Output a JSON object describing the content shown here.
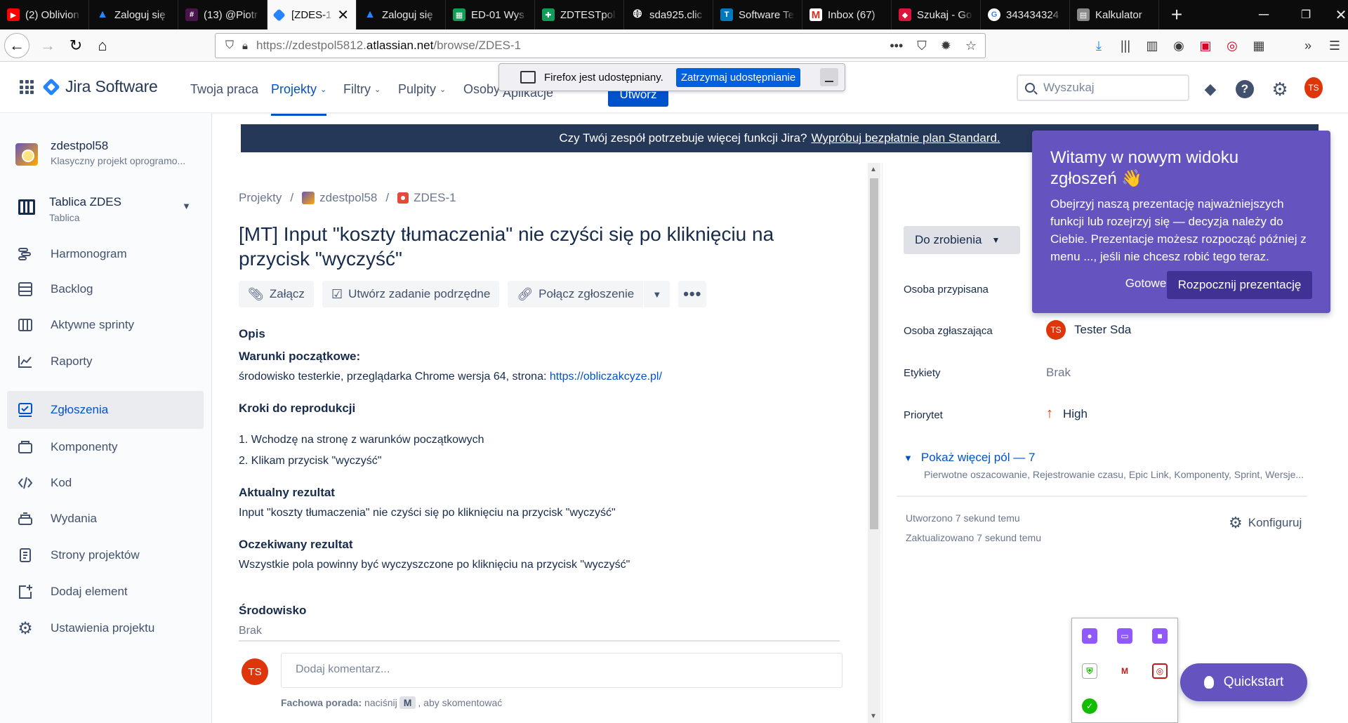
{
  "browser": {
    "tabs": [
      {
        "label": "(2) Oblivion",
        "icon": "youtube-icon",
        "color": "#ff0000"
      },
      {
        "label": "Zaloguj się",
        "icon": "atlassian-icon",
        "color": "#2684ff"
      },
      {
        "label": "(13) @Piotr",
        "icon": "slack-icon",
        "color": "#e01e5a"
      },
      {
        "label": "[ZDES-1",
        "icon": "jira-icon",
        "color": "#2684ff",
        "active": true
      },
      {
        "label": "Zaloguj się",
        "icon": "atlassian-icon",
        "color": "#2684ff"
      },
      {
        "label": "ED-01 Wys",
        "icon": "sheets-icon",
        "color": "#0f9d58"
      },
      {
        "label": "ZDTESTpol",
        "icon": "sheets-icon",
        "color": "#0f9d58"
      },
      {
        "label": "sda925.clic",
        "icon": "globe-icon",
        "color": "#555555"
      },
      {
        "label": "Software Te",
        "icon": "trello-icon",
        "color": "#0079bf"
      },
      {
        "label": "Inbox (67)",
        "icon": "gmail-icon",
        "color": "#d93025"
      },
      {
        "label": "Szukaj - Go",
        "icon": "gov-icon",
        "color": "#dc143c"
      },
      {
        "label": "343434324",
        "icon": "google-icon",
        "color": "#4285f4"
      },
      {
        "label": "Kalkulator",
        "icon": "calc-icon",
        "color": "#777777"
      }
    ],
    "url_prefix": "https://zdestpol5812.",
    "url_domain": "atlassian.net",
    "url_suffix": "/browse/ZDES-1",
    "share_text": "Firefox jest udostępniany.",
    "share_stop": "Zatrzymaj udostępnianie"
  },
  "jira": {
    "product": "Jira Software",
    "menu": [
      "Twoja praca",
      "Projekty",
      "Filtry",
      "Pulpity",
      "Osoby",
      "Aplikacje"
    ],
    "create": "Utwórz",
    "search_placeholder": "Wyszukaj",
    "user_initials": "TS"
  },
  "sidebar": {
    "project_name": "zdestpol58",
    "project_type": "Klasyczny projekt oprogramo...",
    "board_name": "Tablica ZDES",
    "board_type": "Tablica",
    "items": [
      {
        "label": "Harmonogram",
        "icon": "roadmap-icon"
      },
      {
        "label": "Backlog",
        "icon": "backlog-icon"
      },
      {
        "label": "Aktywne sprinty",
        "icon": "sprints-icon"
      },
      {
        "label": "Raporty",
        "icon": "reports-icon"
      },
      {
        "label": "Zgłoszenia",
        "icon": "issues-icon",
        "active": true
      },
      {
        "label": "Komponenty",
        "icon": "components-icon"
      },
      {
        "label": "Kod",
        "icon": "code-icon"
      },
      {
        "label": "Wydania",
        "icon": "releases-icon"
      },
      {
        "label": "Strony projektów",
        "icon": "pages-icon"
      },
      {
        "label": "Dodaj element",
        "icon": "add-item-icon"
      },
      {
        "label": "Ustawienia projektu",
        "icon": "settings-icon"
      }
    ]
  },
  "banner": {
    "text": "Czy Twój zespół potrzebuje więcej funkcji Jira?",
    "link": "Wypróbuj bezpłatnie plan Standard."
  },
  "issue": {
    "breadcrumbs": [
      "Projekty",
      "zdestpol58",
      "ZDES-1"
    ],
    "title": "[MT] Input \"koszty tłumaczenia\" nie czyści się po kliknięciu na przycisk \"wyczyść\"",
    "actions": [
      "Załącz",
      "Utwórz zadanie podrzędne",
      "Połącz zgłoszenie"
    ],
    "description": {
      "label": "Opis",
      "h1": "Warunki początkowe:",
      "p1": "środowisko testerkie, przeglądarka Chrome wersja 64, strona: ",
      "p1_link": "https://obliczakcyze.pl/",
      "h2": "Kroki do reprodukcji",
      "step1": "1. Wchodzę na stronę z warunków początkowych",
      "step2": "2. Klikam przycisk \"wyczyść\"",
      "h3": "Aktualny rezultat",
      "p3": "Input \"koszty tłumaczenia\" nie czyści się po kliknięciu na przycisk \"wyczyść\"",
      "h4": "Oczekiwany rezultat",
      "p4": "Wszystkie pola powinny być wyczyszczone po kliknięciu na przycisk \"wyczyść\"",
      "env_label": "Środowisko",
      "env_value": "Brak"
    },
    "comment_placeholder": "Dodaj komentarz...",
    "tip_label": "Fachowa porada:",
    "tip_pre": "naciśnij",
    "tip_key": "M",
    "tip_post": ", aby skomentować"
  },
  "details": {
    "status": "Do zrobienia",
    "assignee_label": "Osoba przypisana",
    "reporter_label": "Osoba zgłaszająca",
    "reporter": "Tester Sda",
    "reporter_initials": "TS",
    "labels_label": "Etykiety",
    "labels_value": "Brak",
    "priority_label": "Priorytet",
    "priority_value": "High",
    "more_fields": "Pokaż więcej pól — 7",
    "more_fields_desc": "Pierwotne oszacowanie, Rejestrowanie czasu, Epic Link, Komponenty, Sprint, Wersje...",
    "created": "Utworzono 7 sekund temu",
    "updated": "Zaktualizowano 7 sekund temu",
    "configure": "Konfiguruj"
  },
  "onboarding": {
    "title": "Witamy w nowym widoku zgłoszeń 👋",
    "body": "Obejrzyj naszą prezentację najważniejszych funkcji lub rozejrzyj się — decyzja należy do Ciebie. Prezentacje możesz rozpocząć później z menu ..., jeśli nie chcesz robić tego teraz.",
    "done": "Gotowe",
    "start": "Rozpocznij prezentację"
  },
  "quickstart": "Quickstart"
}
